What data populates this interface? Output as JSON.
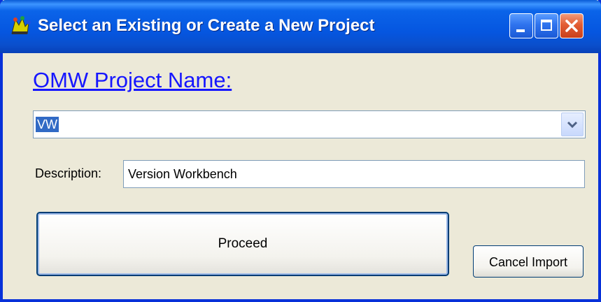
{
  "window": {
    "title": "Select an Existing or Create a New Project",
    "app_icon": "app-icon",
    "controls": {
      "minimize": "minimize-icon",
      "maximize": "maximize-icon",
      "close": "close-icon"
    }
  },
  "form": {
    "project_name_label": "OMW Project Name:",
    "project_combo": {
      "selected_value": "VW",
      "dropdown_icon": "chevron-down-icon"
    },
    "description_label": "Description:",
    "description_value": "Version Workbench"
  },
  "buttons": {
    "proceed_label": "Proceed",
    "cancel_import_label": "Cancel Import"
  },
  "colors": {
    "titlebar": "#0556e0",
    "window_bg": "#ece9d8",
    "link_text": "#1616ff",
    "selection": "#316ac5",
    "close_button": "#e35d33"
  }
}
